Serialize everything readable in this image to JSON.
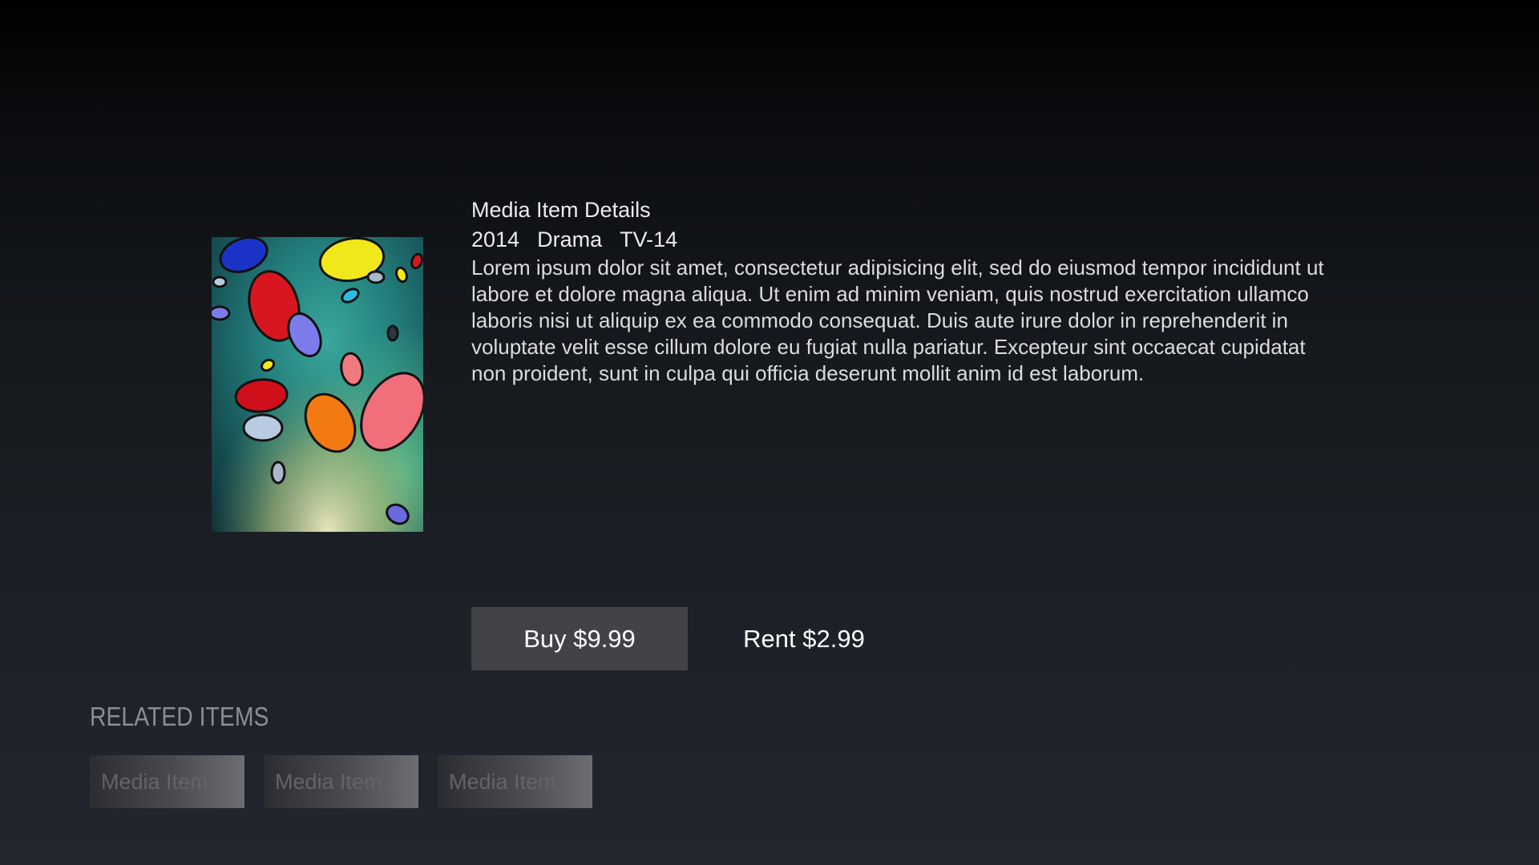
{
  "details": {
    "title": "Media Item Details",
    "year": "2014",
    "genre": "Drama",
    "rating": "TV-14",
    "description": "Lorem ipsum dolor sit amet, consectetur adipisicing elit, sed do eiusmod tempor incididunt ut labore  et dolore magna aliqua. Ut enim ad minim veniam, quis nostrud exercitation ullamco laboris nisi ut aliquip ex ea commodo consequat. Duis aute irure dolor in reprehenderit in voluptate velit esse cillum dolore eu fugiat nulla pariatur. Excepteur sint occaecat cupidatat non proident, sunt in culpa qui officia deserunt mollit anim id est laborum."
  },
  "poster": {
    "icon": "jelly-beans-poster"
  },
  "actions": {
    "buy_label": "Buy $9.99",
    "rent_label": "Rent $2.99"
  },
  "related": {
    "header": "RELATED ITEMS",
    "items": [
      {
        "label": "Media Item 1"
      },
      {
        "label": "Media Item 2"
      },
      {
        "label": "Media Item 3"
      }
    ]
  },
  "colors": {
    "background_top": "#000000",
    "background_bottom": "#23262f",
    "buy_button": "#414347",
    "related_header": "#8a8e96"
  }
}
